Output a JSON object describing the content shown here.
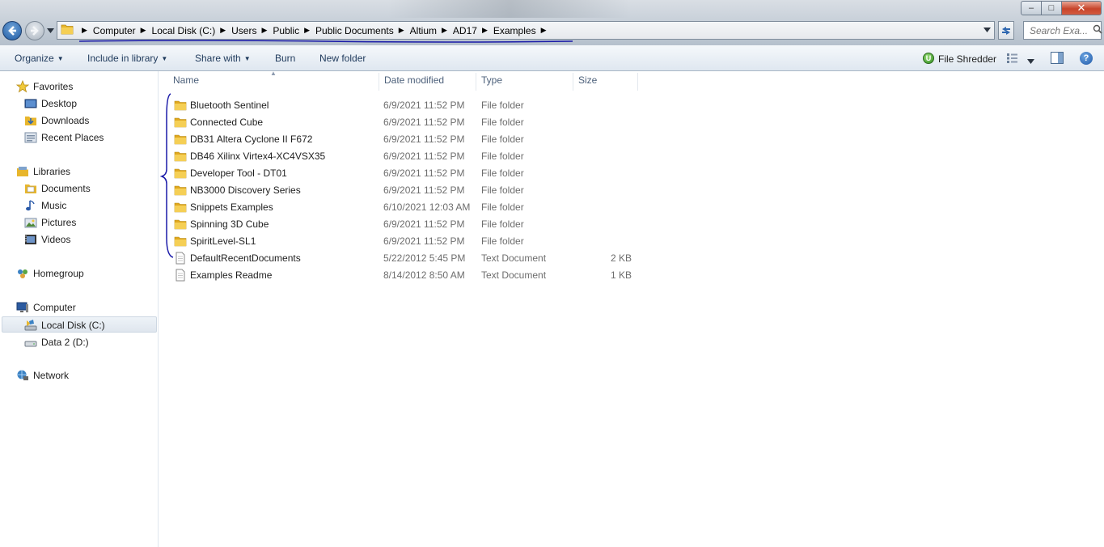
{
  "window": {
    "minimize_glyph": "–",
    "maximize_glyph": "□",
    "close_glyph": "✕"
  },
  "address": {
    "breadcrumbs": [
      "Computer",
      "Local Disk (C:)",
      "Users",
      "Public",
      "Public Documents",
      "Altium",
      "AD17",
      "Examples"
    ],
    "search_placeholder": "Search Exa..."
  },
  "toolbar": {
    "organize": "Organize",
    "include_in_library": "Include in library",
    "share_with": "Share with",
    "burn": "Burn",
    "new_folder": "New folder",
    "file_shredder": "File Shredder"
  },
  "nav": {
    "favorites": "Favorites",
    "desktop": "Desktop",
    "downloads": "Downloads",
    "recent_places": "Recent Places",
    "libraries": "Libraries",
    "documents": "Documents",
    "music": "Music",
    "pictures": "Pictures",
    "videos": "Videos",
    "homegroup": "Homegroup",
    "computer": "Computer",
    "local_disk": "Local Disk (C:)",
    "data2": "Data 2 (D:)",
    "network": "Network"
  },
  "columns": {
    "name": "Name",
    "date_modified": "Date modified",
    "type": "Type",
    "size": "Size"
  },
  "files": [
    {
      "name": "Bluetooth Sentinel",
      "date": "6/9/2021 11:52 PM",
      "type": "File folder",
      "size": "",
      "icon": "folder-icon"
    },
    {
      "name": "Connected Cube",
      "date": "6/9/2021 11:52 PM",
      "type": "File folder",
      "size": "",
      "icon": "folder-icon"
    },
    {
      "name": "DB31 Altera Cyclone II F672",
      "date": "6/9/2021 11:52 PM",
      "type": "File folder",
      "size": "",
      "icon": "folder-icon"
    },
    {
      "name": "DB46 Xilinx Virtex4-XC4VSX35",
      "date": "6/9/2021 11:52 PM",
      "type": "File folder",
      "size": "",
      "icon": "folder-icon"
    },
    {
      "name": "Developer Tool - DT01",
      "date": "6/9/2021 11:52 PM",
      "type": "File folder",
      "size": "",
      "icon": "folder-icon"
    },
    {
      "name": "NB3000 Discovery Series",
      "date": "6/9/2021 11:52 PM",
      "type": "File folder",
      "size": "",
      "icon": "folder-icon"
    },
    {
      "name": "Snippets Examples",
      "date": "6/10/2021 12:03 AM",
      "type": "File folder",
      "size": "",
      "icon": "folder-icon"
    },
    {
      "name": "Spinning 3D Cube",
      "date": "6/9/2021 11:52 PM",
      "type": "File folder",
      "size": "",
      "icon": "folder-icon"
    },
    {
      "name": "SpiritLevel-SL1",
      "date": "6/9/2021 11:52 PM",
      "type": "File folder",
      "size": "",
      "icon": "folder-icon"
    },
    {
      "name": "DefaultRecentDocuments",
      "date": "5/22/2012 5:45 PM",
      "type": "Text Document",
      "size": "2 KB",
      "icon": "text-document-icon"
    },
    {
      "name": "Examples Readme",
      "date": "8/14/2012 8:50 AM",
      "type": "Text Document",
      "size": "1 KB",
      "icon": "text-document-icon"
    }
  ],
  "colors": {
    "annotation_ink": "#1a1aa8",
    "folder_yellow": "#e8b62c",
    "link_blue": "#1e395b"
  }
}
